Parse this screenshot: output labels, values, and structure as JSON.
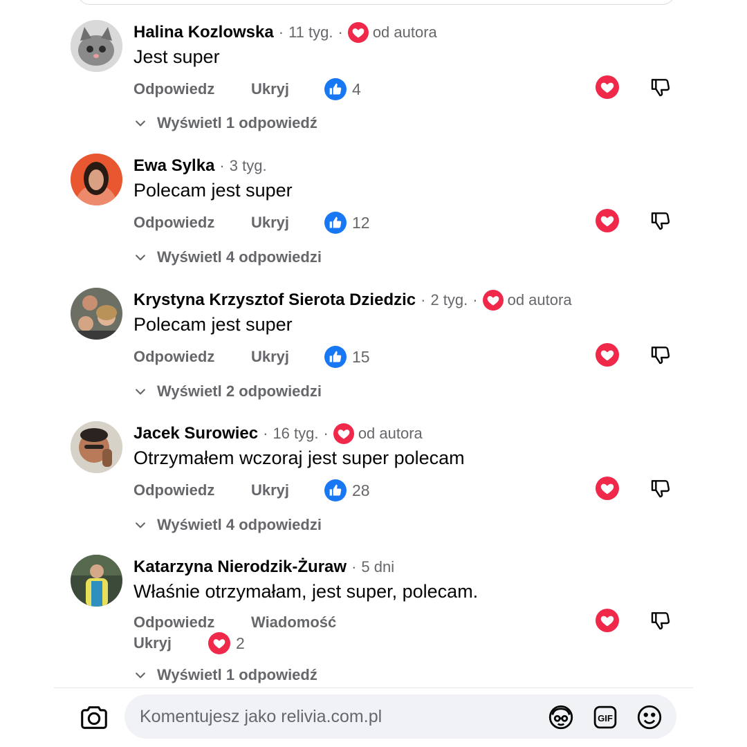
{
  "comments": [
    {
      "author": "Halina Kozlowska",
      "time": "11 tyg.",
      "author_badge": "od autora",
      "text": "Jest super",
      "reply_label": "Odpowiedz",
      "hide_label": "Ukryj",
      "reaction_icon": "like-icon",
      "reaction_count": "4",
      "view_replies": "Wyświetl 1 odpowiedź"
    },
    {
      "author": "Ewa Sylka",
      "time": "3 tyg.",
      "text": "Polecam jest super",
      "reply_label": "Odpowiedz",
      "hide_label": "Ukryj",
      "reaction_icon": "like-icon",
      "reaction_count": "12",
      "view_replies": "Wyświetl 4 odpowiedzi"
    },
    {
      "author": "Krystyna Krzysztof Sierota Dziedzic",
      "time": "2 tyg.",
      "author_badge": "od autora",
      "text": "Polecam jest super",
      "reply_label": "Odpowiedz",
      "hide_label": "Ukryj",
      "reaction_icon": "like-icon",
      "reaction_count": "15",
      "view_replies": "Wyświetl 2 odpowiedzi"
    },
    {
      "author": "Jacek Surowiec",
      "time": "16 tyg.",
      "author_badge": "od autora",
      "text": "Otrzymałem wczoraj jest super polecam",
      "reply_label": "Odpowiedz",
      "hide_label": "Ukryj",
      "reaction_icon": "like-icon",
      "reaction_count": "28",
      "view_replies": "Wyświetl 4 odpowiedzi"
    },
    {
      "author": "Katarzyna Nierodzik-Żuraw",
      "time": "5 dni",
      "text": "Właśnie otrzymałam, jest super, polecam.",
      "reply_label": "Odpowiedz",
      "message_label": "Wiadomość",
      "hide_label": "Ukryj",
      "reaction_icon": "love-icon",
      "reaction_count": "2",
      "view_replies": "Wyświetl 1 odpowiedź"
    }
  ],
  "composer": {
    "placeholder": "Komentujesz jako relivia.com.pl",
    "icons": [
      "camera-icon",
      "avatar-sticker-icon",
      "gif-icon",
      "emoji-icon"
    ]
  },
  "colors": {
    "like_blue": "#1877f2",
    "love_red": "#f02849",
    "secondary_text": "#65676b",
    "input_bg": "#f0f2f5"
  }
}
